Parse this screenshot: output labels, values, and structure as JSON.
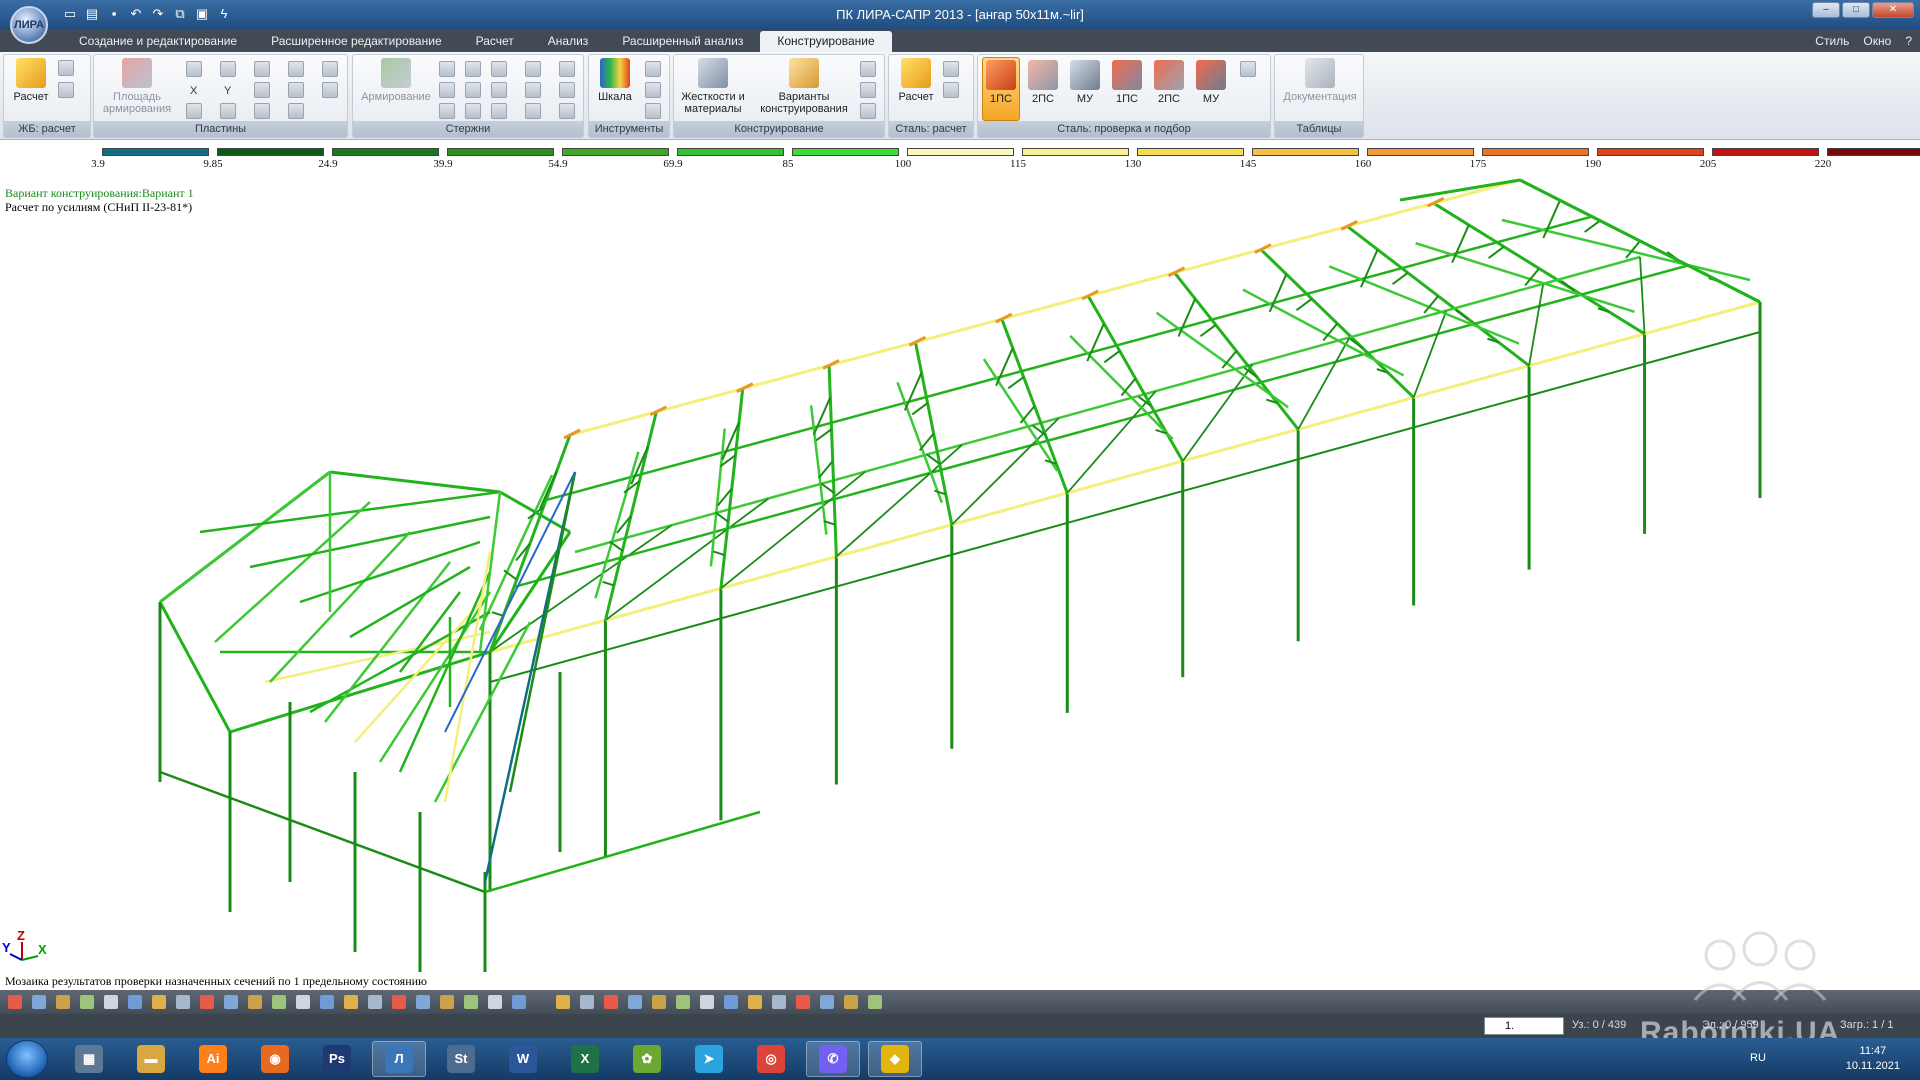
{
  "window": {
    "title": "ПК ЛИРА-САПР 2013 - [ангар 50х11м.~lir]",
    "logo": "ЛИРА"
  },
  "quick_access": [
    "new-icon",
    "open-icon",
    "save-icon",
    "undo-icon",
    "redo-icon",
    "copy-icon",
    "paste-icon",
    "bolt-icon"
  ],
  "tabs": [
    {
      "label": "Создание и редактирование"
    },
    {
      "label": "Расширенное редактирование"
    },
    {
      "label": "Расчет"
    },
    {
      "label": "Анализ"
    },
    {
      "label": "Расширенный анализ"
    },
    {
      "label": "Конструирование"
    }
  ],
  "tab_right": {
    "style": "Стиль",
    "window": "Окно",
    "help": "?"
  },
  "ribbon": {
    "groups": {
      "rc_calc": "ЖБ: расчет",
      "plates": "Пластины",
      "rods": "Стержни",
      "tools": "Инструменты",
      "design": "Конструирование",
      "steel_calc": "Сталь: расчет",
      "steel_check": "Сталь: проверка и подбор",
      "tables": "Таблицы"
    },
    "buttons": {
      "calc": "Расчет",
      "area_reinf_1": "Площадь",
      "area_reinf_2": "армирования",
      "x": "X",
      "y": "Y",
      "reinf": "Армирование",
      "scale": "Шкала",
      "stiff_1": "Жесткости и",
      "stiff_2": "материалы",
      "variants_1": "Варианты",
      "variants_2": "конструирования",
      "steel_calc": "Расчет",
      "ps1": "1ПС",
      "ps2": "2ПС",
      "mu": "МУ",
      "ps1b": "1ПС",
      "ps2b": "2ПС",
      "mub": "МУ",
      "docs": "Документация"
    }
  },
  "scale": {
    "ticks": [
      "3.9",
      "9.85",
      "24.9",
      "39.9",
      "54.9",
      "69.9",
      "85",
      "100",
      "115",
      "130",
      "145",
      "160",
      "175",
      "190",
      "205",
      "220"
    ],
    "colors": [
      "#0e6f84",
      "#0b5a17",
      "#1b7a1b",
      "#2d8f1f",
      "#3da82a",
      "#36c232",
      "#3ddc3a",
      "#fbf7bf",
      "#f7f090",
      "#f5dd55",
      "#f4bd46",
      "#f29a3a",
      "#ec7326",
      "#e0431c",
      "#c21414",
      "#7a0a0a"
    ]
  },
  "info": {
    "variant": "Вариант конструирования:Вариант 1",
    "method": "Расчет по усилиям (СНиП II-23-81*)",
    "mosaic": "Мозаика результатов проверки назначенных сечений по 1 предельному состоянию"
  },
  "axes": {
    "z": "Z",
    "y": "Y",
    "x": "X"
  },
  "statusbar": {
    "combo": "1.",
    "nodes": "Уз.: 0 / 439",
    "mid": "Эл.: 0 / 959",
    "load": "Загр.: 1 / 1"
  },
  "watermark": "Rabotniki.UA",
  "taskbar": {
    "apps": [
      {
        "icon": "calculator-icon",
        "glyph": "▦"
      },
      {
        "icon": "folder-icon",
        "glyph": "▬"
      },
      {
        "icon": "illustrator-icon",
        "glyph": "Ai"
      },
      {
        "icon": "firefox-icon",
        "glyph": "◉"
      },
      {
        "icon": "photoshop-icon",
        "glyph": "Ps"
      },
      {
        "icon": "lira-icon",
        "glyph": "Л"
      },
      {
        "icon": "steel-icon",
        "glyph": "St"
      },
      {
        "icon": "word-icon",
        "glyph": "W"
      },
      {
        "icon": "excel-icon",
        "glyph": "X"
      },
      {
        "icon": "plant-icon",
        "glyph": "✿"
      },
      {
        "icon": "telegram-icon",
        "glyph": "➤"
      },
      {
        "icon": "chrome-icon",
        "glyph": "◎"
      },
      {
        "icon": "viber-icon",
        "glyph": "✆"
      },
      {
        "icon": "batman-icon",
        "glyph": "◆"
      }
    ],
    "lang": "RU",
    "time": "11:47",
    "date": "10.11.2021"
  }
}
